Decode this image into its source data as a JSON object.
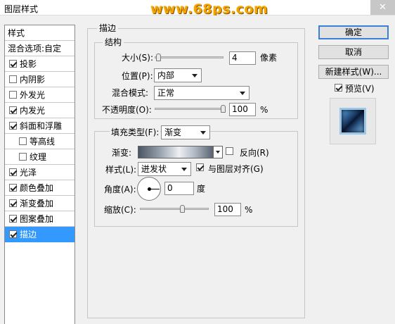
{
  "window": {
    "title": "图层样式",
    "watermark": "www.68ps.com",
    "close_label": "✕"
  },
  "left_panel": {
    "header": "样式",
    "blend_label": "混合选项:自定",
    "items": [
      {
        "label": "投影",
        "checked": true,
        "indent": false,
        "selected": false
      },
      {
        "label": "内阴影",
        "checked": false,
        "indent": false,
        "selected": false
      },
      {
        "label": "外发光",
        "checked": false,
        "indent": false,
        "selected": false
      },
      {
        "label": "内发光",
        "checked": true,
        "indent": false,
        "selected": false
      },
      {
        "label": "斜面和浮雕",
        "checked": true,
        "indent": false,
        "selected": false
      },
      {
        "label": "等高线",
        "checked": false,
        "indent": true,
        "selected": false
      },
      {
        "label": "纹理",
        "checked": false,
        "indent": true,
        "selected": false
      },
      {
        "label": "光泽",
        "checked": true,
        "indent": false,
        "selected": false
      },
      {
        "label": "颜色叠加",
        "checked": true,
        "indent": false,
        "selected": false
      },
      {
        "label": "渐变叠加",
        "checked": true,
        "indent": false,
        "selected": false
      },
      {
        "label": "图案叠加",
        "checked": true,
        "indent": false,
        "selected": false
      },
      {
        "label": "描边",
        "checked": true,
        "indent": false,
        "selected": true
      }
    ]
  },
  "stroke": {
    "group_title": "描边",
    "structure_title": "结构",
    "size_label": "大小(S):",
    "size_value": "4",
    "size_unit": "像素",
    "position_label": "位置(P):",
    "position_value": "内部",
    "blend_mode_label": "混合模式:",
    "blend_mode_value": "正常",
    "opacity_label": "不透明度(O):",
    "opacity_value": "100",
    "opacity_unit": "%",
    "fill_type_label": "填充类型(F):",
    "fill_type_value": "渐变",
    "gradient_label": "渐变:",
    "reverse_label": "反向(R)",
    "reverse_checked": false,
    "style_label": "样式(L):",
    "style_value": "迸发状",
    "align_label": "与图层对齐(G)",
    "align_checked": true,
    "angle_label": "角度(A):",
    "angle_value": "0",
    "angle_unit": "度",
    "scale_label": "缩放(C):",
    "scale_value": "100",
    "scale_unit": "%"
  },
  "buttons": {
    "ok": "确定",
    "cancel": "取消",
    "new_style": "新建样式(W)...",
    "preview_label": "预览(V)",
    "preview_checked": true
  }
}
